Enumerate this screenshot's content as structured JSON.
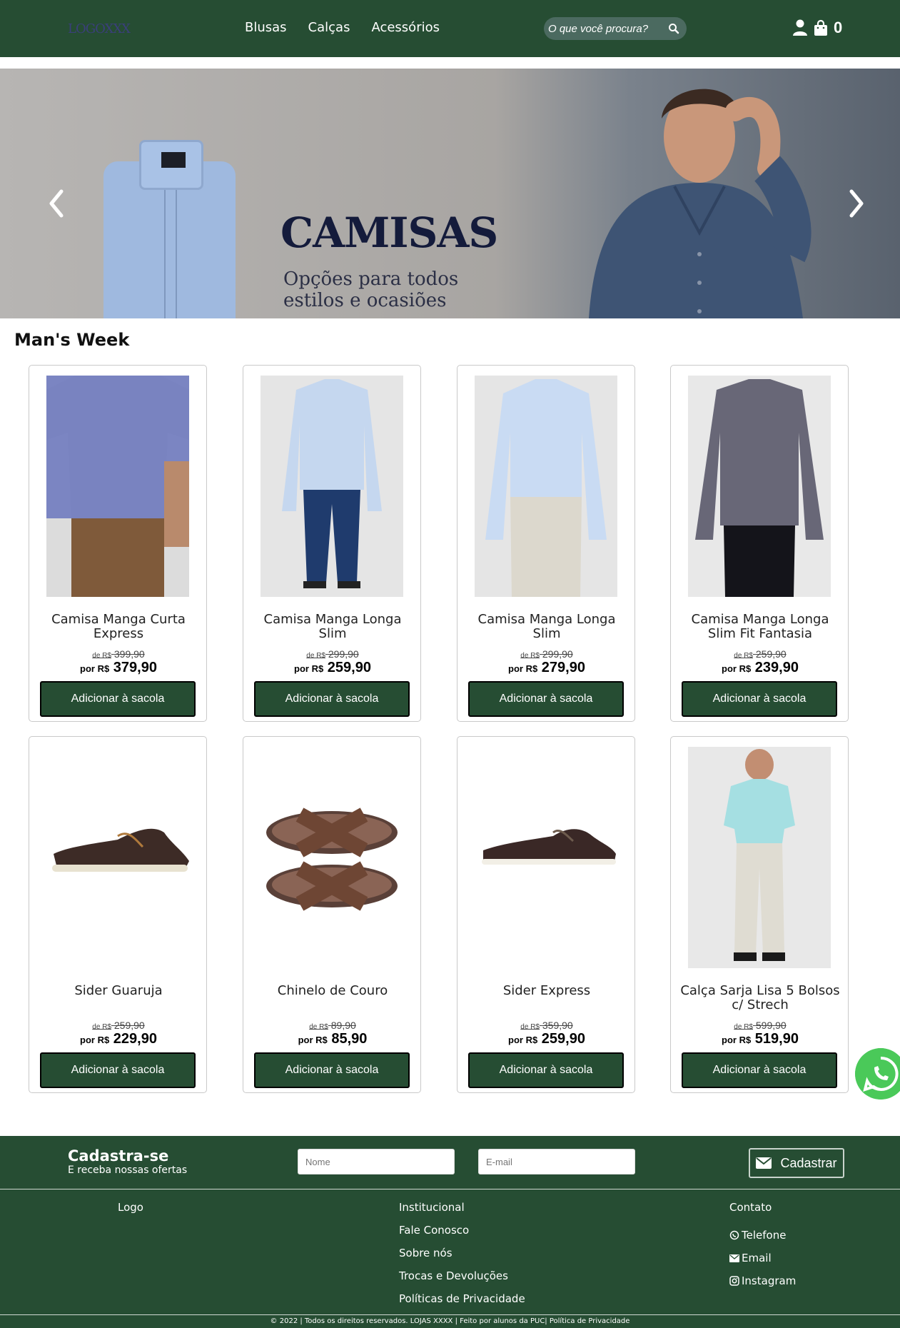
{
  "header": {
    "logo": "LOGOXXX",
    "nav": [
      "Blusas",
      "Calças",
      "Acessórios"
    ],
    "search_placeholder": "O que você procura?",
    "cart_count": "0"
  },
  "banner": {
    "title": "CAMISAS",
    "subtitle": "Opções para todos estilos e ocasiões"
  },
  "section_title": "Man's Week",
  "products": [
    {
      "name": "Camisa Manga Curta Express",
      "old_prefix": "de R$",
      "old_price": "399,90",
      "new_prefix": "por R$",
      "new_price": "379,90",
      "button": "Adicionar à sacola"
    },
    {
      "name": "Camisa Manga Longa Slim",
      "old_prefix": "de R$",
      "old_price": "299,90",
      "new_prefix": "por R$",
      "new_price": "259,90",
      "button": "Adicionar à sacola"
    },
    {
      "name": "Camisa Manga Longa Slim",
      "old_prefix": "de R$",
      "old_price": "299,90",
      "new_prefix": "por R$",
      "new_price": "279,90",
      "button": "Adicionar à sacola"
    },
    {
      "name": "Camisa Manga Longa Slim Fit Fantasia",
      "old_prefix": "de R$",
      "old_price": "259,90",
      "new_prefix": "por R$",
      "new_price": "239,90",
      "button": "Adicionar à sacola"
    },
    {
      "name": "Sider Guaruja",
      "old_prefix": "de R$",
      "old_price": "259,90",
      "new_prefix": "por R$",
      "new_price": "229,90",
      "button": "Adicionar à sacola"
    },
    {
      "name": "Chinelo de Couro",
      "old_prefix": "de R$",
      "old_price": "89,90",
      "new_prefix": "por R$",
      "new_price": "85,90",
      "button": "Adicionar à sacola"
    },
    {
      "name": "Sider Express",
      "old_prefix": "de R$",
      "old_price": "359,90",
      "new_prefix": "por R$",
      "new_price": "259,90",
      "button": "Adicionar à sacola"
    },
    {
      "name": "Calça Sarja Lisa 5 Bolsos c/ Strech",
      "old_prefix": "de R$",
      "old_price": "599,90",
      "new_prefix": "por R$",
      "new_price": "519,90",
      "button": "Adicionar à sacola"
    }
  ],
  "newsletter": {
    "title": "Cadastra-se",
    "subtitle": "E receba nossas ofertas",
    "name_placeholder": "Nome",
    "email_placeholder": "E-mail",
    "button": "Cadastrar"
  },
  "footer": {
    "logo": "Logo",
    "institutional": [
      "Institucional",
      "Fale Conosco",
      "Sobre nós",
      "Trocas e Devoluções",
      "Políticas de Privacidade"
    ],
    "contact_title": "Contato",
    "contact": [
      "Telefone",
      "Email",
      "Instagram"
    ],
    "copyright": "© 2022 | Todos os direitos reservados. LOJAS XXXX | Feito por alunos da PUC| Política de Privacidade"
  },
  "colors": {
    "brand_green": "#264d33",
    "whatsapp_green": "#4ac959"
  }
}
